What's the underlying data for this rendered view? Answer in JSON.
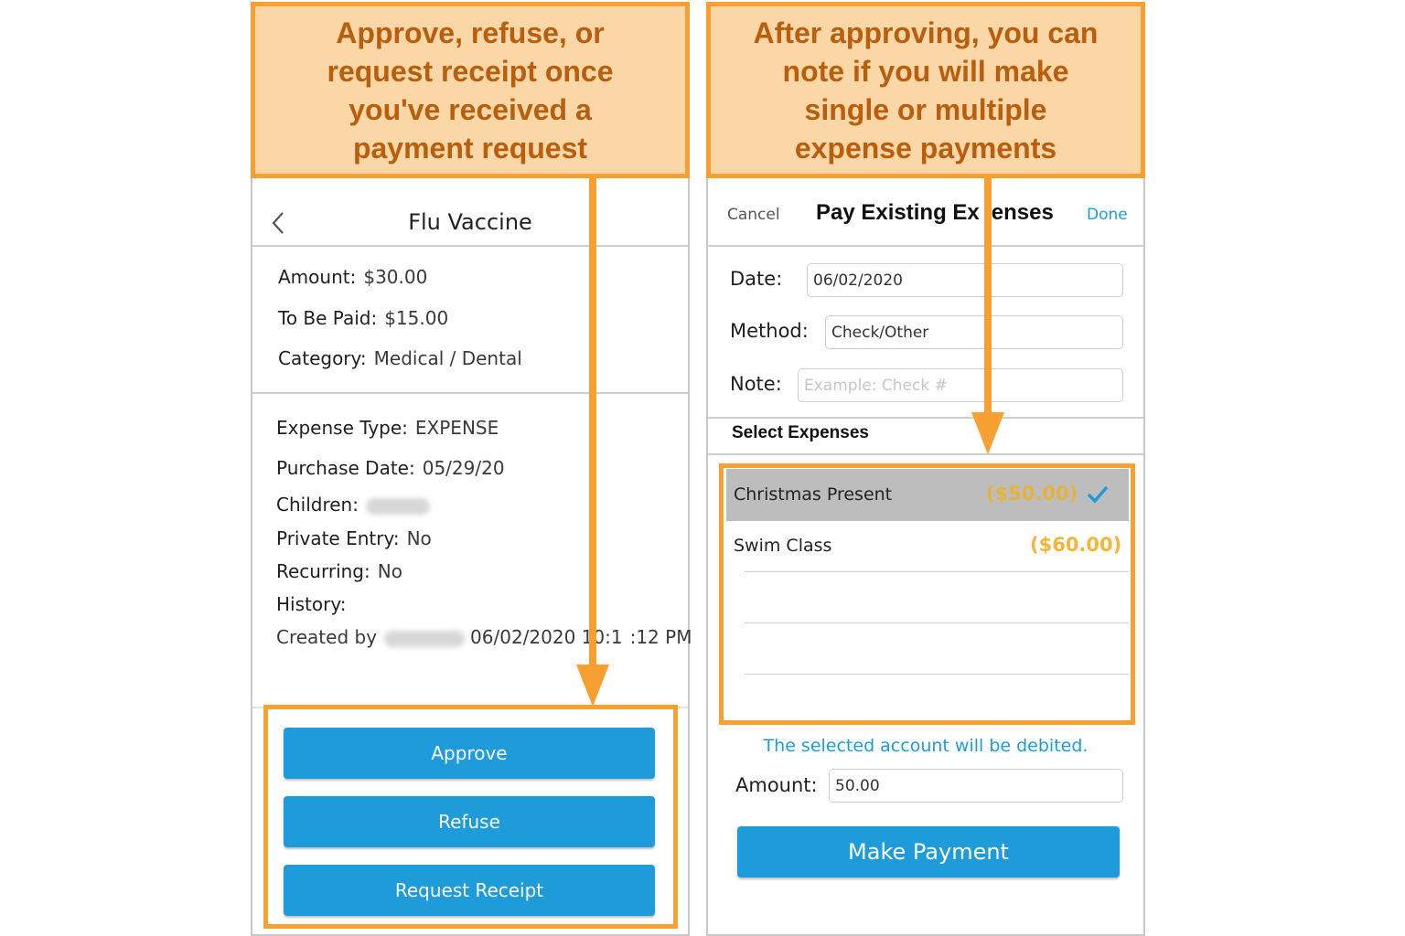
{
  "callouts": {
    "left": "Approve, refuse, or\nrequest receipt once\nyou've received a\npayment request",
    "right": "After approving, you can\nnote if you will make\nsingle or multiple\nexpense payments"
  },
  "left_screen": {
    "title": "Flu Vaccine",
    "back_icon": "chevron-left-icon",
    "amount_label": "Amount:",
    "amount_value": "$30.00",
    "to_be_paid_label": "To Be Paid:",
    "to_be_paid_value": "$15.00",
    "category_label": "Category:",
    "category_value": "Medical / Dental",
    "expense_type_label": "Expense Type:",
    "expense_type_value": "EXPENSE",
    "purchase_date_label": "Purchase Date:",
    "purchase_date_value": "05/29/20",
    "children_label": "Children:",
    "private_label": "Private Entry:",
    "private_value": "No",
    "recurring_label": "Recurring:",
    "recurring_value": "No",
    "history_label": "History:",
    "created_by_label": "Created by",
    "created_datetime": "06/02/2020 10:1",
    "created_datetime_tail": ":12 PM",
    "buttons": {
      "approve": "Approve",
      "refuse": "Refuse",
      "request_receipt": "Request Receipt"
    }
  },
  "right_screen": {
    "cancel": "Cancel",
    "title_part1": "Pay Existing Ex",
    "title_part2": "enses",
    "done": "Done",
    "date_label": "Date:",
    "date_value": "06/02/2020",
    "method_label": "Method:",
    "method_value": "Check/Other",
    "note_label": "Note:",
    "note_placeholder": "Example: Check #",
    "select_expenses_header": "Select Expenses",
    "expenses": [
      {
        "name": "Christmas Present",
        "amount": "($50.00)",
        "selected": true
      },
      {
        "name": "Swim Class",
        "amount": "($60.00)",
        "selected": false
      }
    ],
    "check_icon": "checkmark-icon",
    "debit_notice": "The selected account will be debited.",
    "amount_label": "Amount:",
    "amount_value": "50.00",
    "make_payment": "Make Payment"
  },
  "colors": {
    "accent": "#1e9cd9",
    "callout_fill": "#fbd7a8",
    "callout_border": "#f5a030",
    "callout_text": "#b85e0c",
    "amount_orange": "#f3b63a"
  }
}
